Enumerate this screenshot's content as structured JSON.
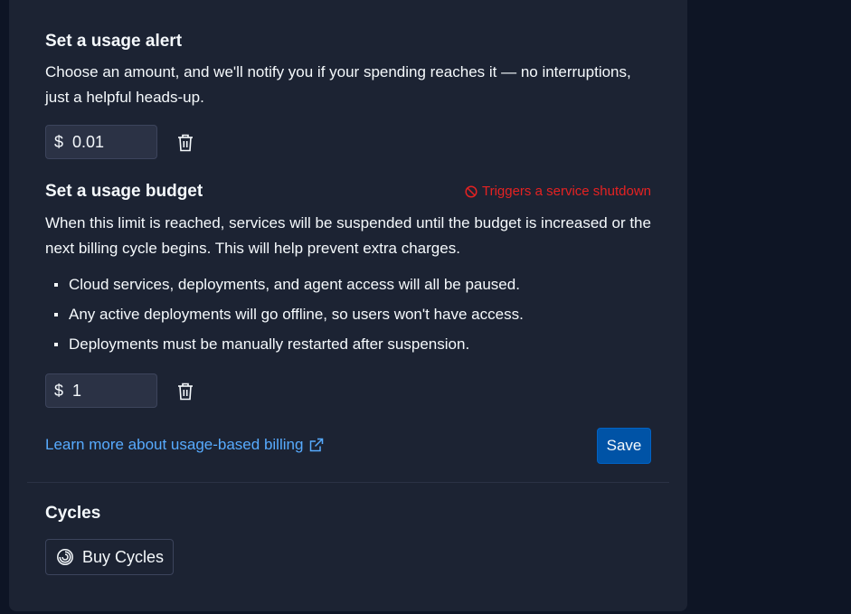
{
  "alert": {
    "title": "Set a usage alert",
    "description": "Choose an amount, and we'll notify you if your spending reaches it — no interruptions, just a helpful heads-up.",
    "currency": "$",
    "value": "0.01"
  },
  "budget": {
    "title": "Set a usage budget",
    "warning": "Triggers a service shutdown",
    "description": "When this limit is reached, services will be suspended until the budget is increased or the next billing cycle begins. This will help prevent extra charges.",
    "bullets": [
      "Cloud services, deployments, and agent access will all be paused.",
      "Any active deployments will go offline, so users won't have access.",
      "Deployments must be manually restarted after suspension."
    ],
    "currency": "$",
    "value": "1"
  },
  "footer": {
    "learn_more": "Learn more about usage-based billing",
    "save_label": "Save"
  },
  "cycles": {
    "title": "Cycles",
    "buy_label": "Buy Cycles"
  },
  "colors": {
    "background": "#0e1525",
    "panel": "#1c2333",
    "warning": "#e52222",
    "link": "#57abff",
    "primary_button": "#0053a6"
  }
}
